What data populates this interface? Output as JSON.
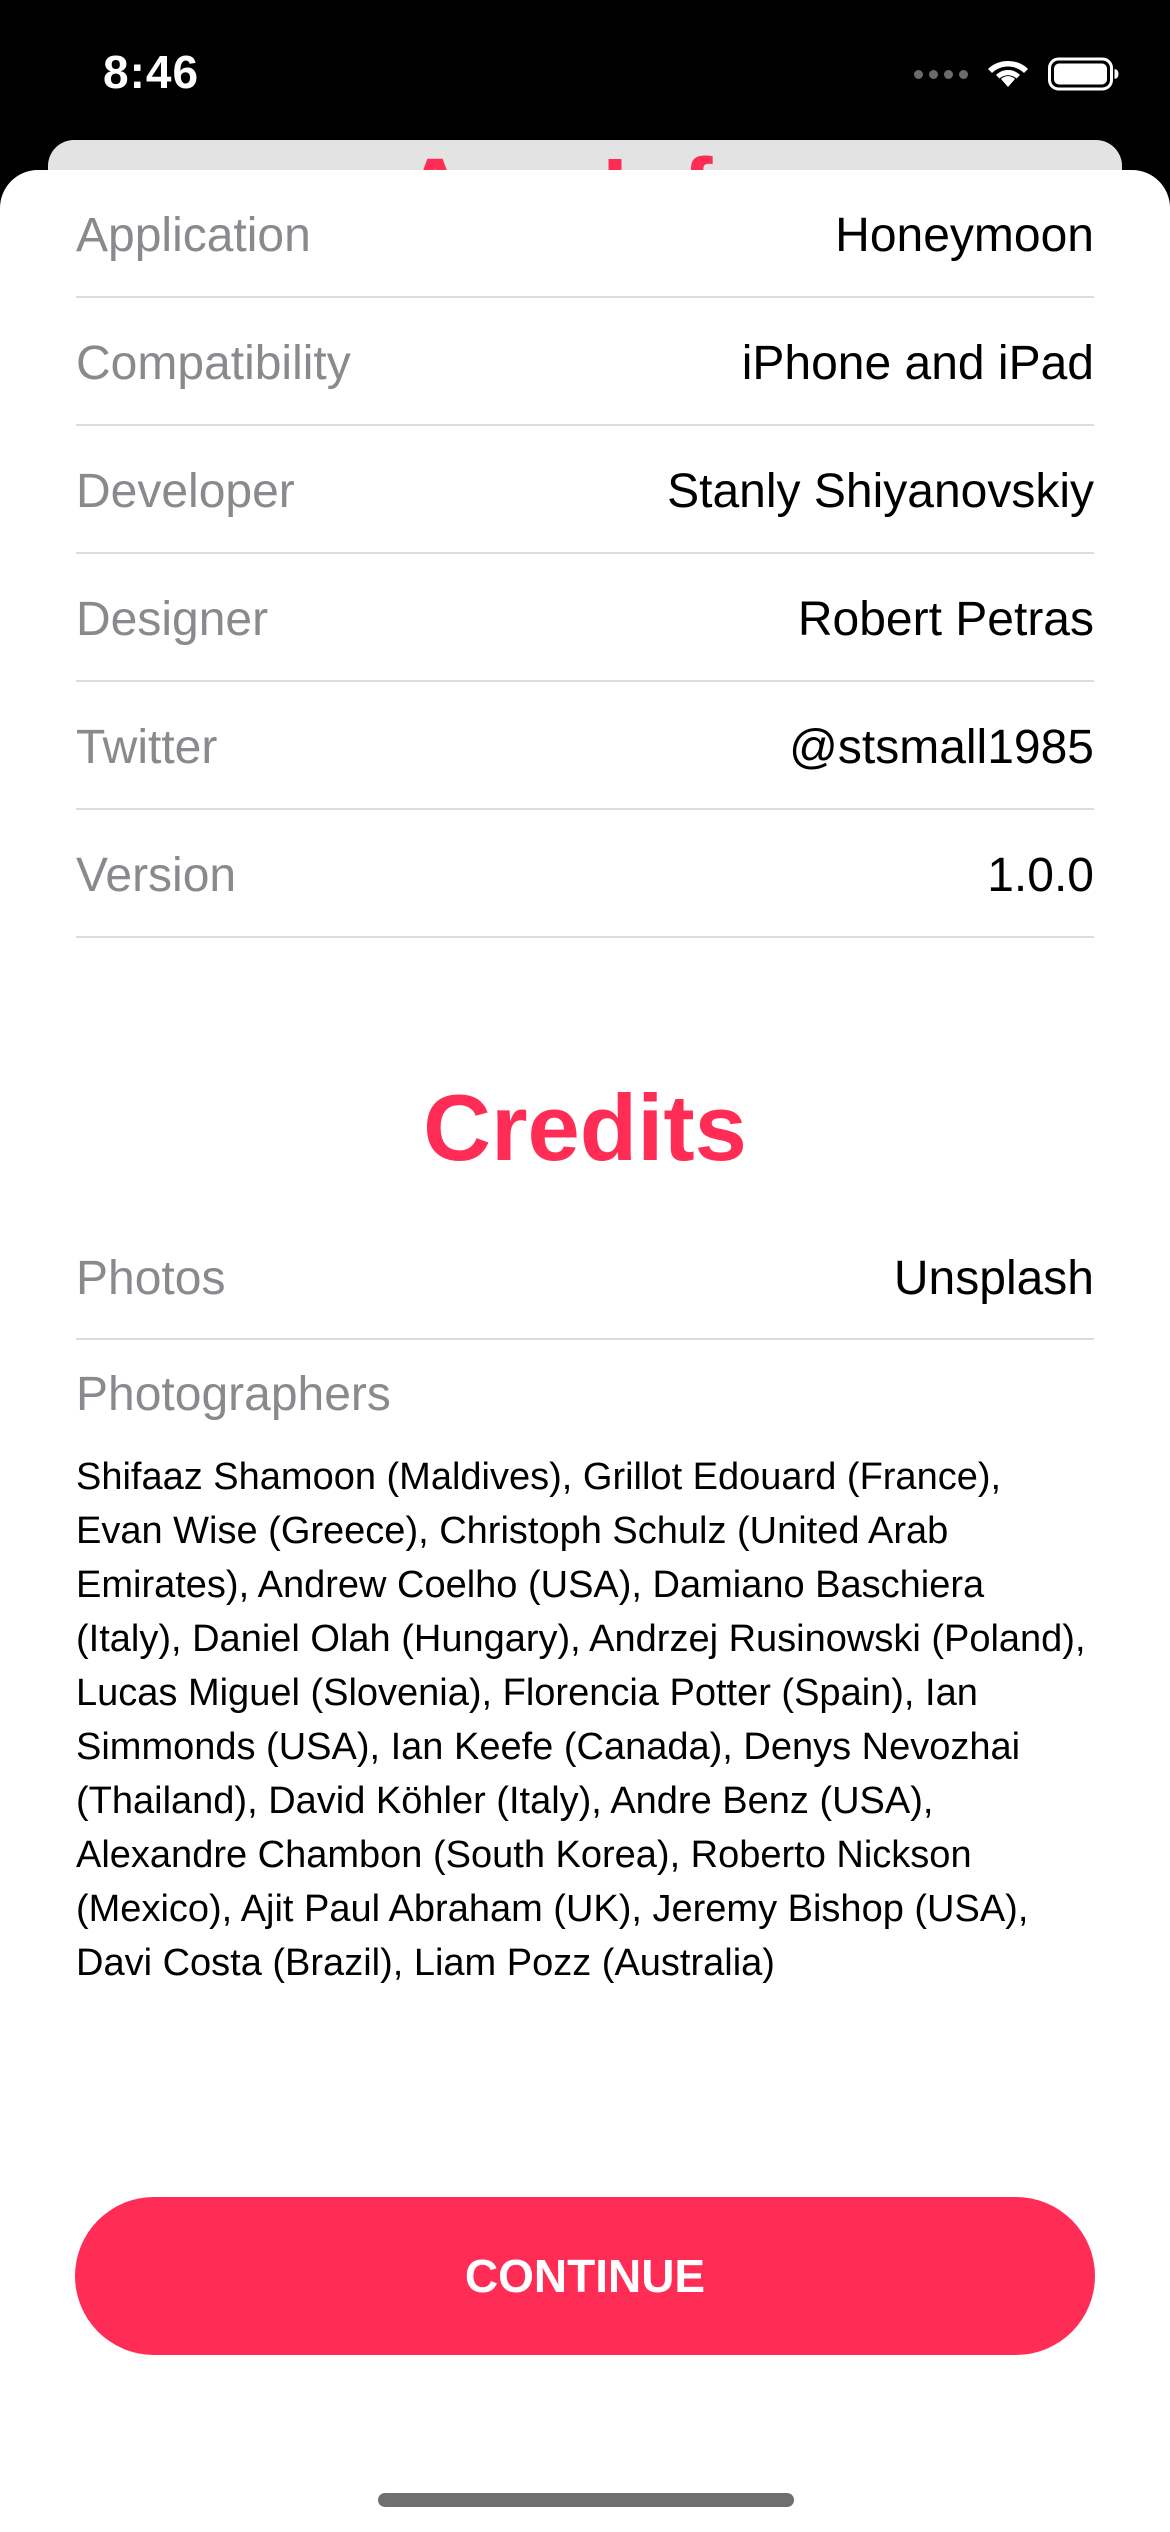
{
  "status_bar": {
    "time": "8:46",
    "icons": [
      "signal-dots-icon",
      "wifi-icon",
      "battery-icon"
    ]
  },
  "background_sheet": {
    "title": "App Info"
  },
  "app_info": {
    "rows": [
      {
        "label": "Application",
        "value": "Honeymoon"
      },
      {
        "label": "Compatibility",
        "value": "iPhone and iPad"
      },
      {
        "label": "Developer",
        "value": "Stanly Shiyanovskiy"
      },
      {
        "label": "Designer",
        "value": "Robert Petras"
      },
      {
        "label": "Twitter",
        "value": "@stsmall1985"
      },
      {
        "label": "Version",
        "value": "1.0.0"
      }
    ]
  },
  "credits": {
    "heading": "Credits",
    "photos_label": "Photos",
    "photos_value": "Unsplash",
    "photographers_label": "Photographers",
    "photographers_text": "Shifaaz Shamoon (Maldives), Grillot Edouard (France), Evan Wise (Greece), Christoph Schulz (United Arab Emirates), Andrew Coelho (USA), Damiano Baschiera (Italy), Daniel Olah (Hungary), Andrzej Rusinowski (Poland), Lucas Miguel (Slovenia), Florencia Potter (Spain), Ian Simmonds (USA), Ian Keefe (Canada), Denys Nevozhai (Thailand), David Köhler (Italy), Andre Benz (USA), Alexandre Chambon (South Korea), Roberto Nickson (Mexico), Ajit Paul Abraham (UK), Jeremy Bishop (USA), Davi Costa (Brazil), Liam Pozz (Australia)"
  },
  "actions": {
    "continue_label": "CONTINUE"
  },
  "colors": {
    "accent": "#ff2d55",
    "label_gray": "#8a8a8e",
    "separator": "#dcdcdc"
  }
}
